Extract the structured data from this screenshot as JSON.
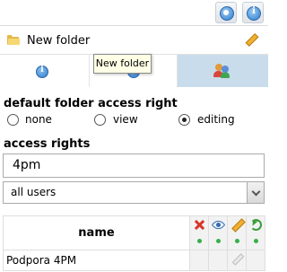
{
  "toolbar": {
    "settings_icon": "settings-ring-icon",
    "info_icon": "info-icon"
  },
  "folder": {
    "title": "New folder",
    "icon": "folder-icon",
    "edit_icon": "pencil-icon"
  },
  "tabs": [
    {
      "icon": "info-icon",
      "active": false
    },
    {
      "icon": "info-icon",
      "active": false
    },
    {
      "icon": "users-icon",
      "active": true
    }
  ],
  "tooltip": {
    "text": "New folder"
  },
  "default_access": {
    "heading": "default folder access right",
    "options": [
      "none",
      "view",
      "editing"
    ],
    "selected": "editing"
  },
  "access_rights": {
    "heading": "access rights",
    "search_value": "4pm",
    "group_select": "all users",
    "table": {
      "header": "name",
      "column_icons": [
        "delete-icon",
        "view-icon",
        "edit-icon",
        "undo-icon"
      ],
      "rows": [
        {
          "name": "Podpora 4PM"
        }
      ]
    }
  },
  "colors": {
    "active_tab": "#c9dceb",
    "accent_blue": "#2f7dd0",
    "status_green": "#36b04a"
  }
}
